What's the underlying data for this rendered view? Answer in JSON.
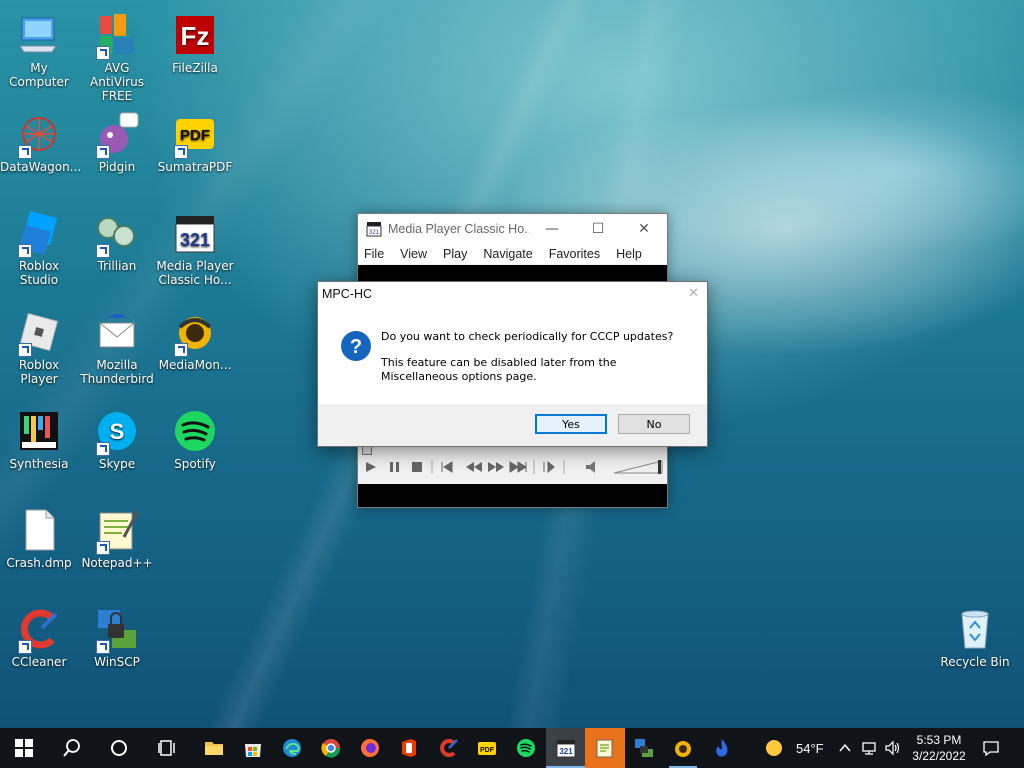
{
  "desktop": {
    "icons": [
      {
        "label": "My Computer"
      },
      {
        "label": "AVG AntiVirus FREE"
      },
      {
        "label": "FileZilla"
      },
      {
        "label": "DataWagon..."
      },
      {
        "label": "Pidgin"
      },
      {
        "label": "SumatraPDF"
      },
      {
        "label": "Roblox Studio"
      },
      {
        "label": "Trillian"
      },
      {
        "label": "Media Player Classic Ho..."
      },
      {
        "label": "Roblox Player"
      },
      {
        "label": "Mozilla Thunderbird"
      },
      {
        "label": "MediaMon..."
      },
      {
        "label": "Synthesia"
      },
      {
        "label": "Skype"
      },
      {
        "label": "Spotify"
      },
      {
        "label": "Crash.dmp"
      },
      {
        "label": "Notepad++"
      },
      {
        "label": "CCleaner"
      },
      {
        "label": "WinSCP"
      },
      {
        "label": "Recycle Bin"
      }
    ]
  },
  "mpc": {
    "title": "Media Player Classic Ho...",
    "menu": [
      "File",
      "View",
      "Play",
      "Navigate",
      "Favorites",
      "Help"
    ]
  },
  "dialog": {
    "title": "MPC-HC",
    "message": "Do you want to check periodically for CCCP updates?",
    "detail": "This feature can be disabled later from the Miscellaneous options page.",
    "yes_label": "Yes",
    "no_label": "No"
  },
  "taskbar": {
    "weather": "54°F",
    "time": "5:53 PM",
    "date": "3/22/2022"
  },
  "colors": {
    "accent": "#0078d7",
    "taskbar": "#101418",
    "question_icon": "#1565c0"
  }
}
